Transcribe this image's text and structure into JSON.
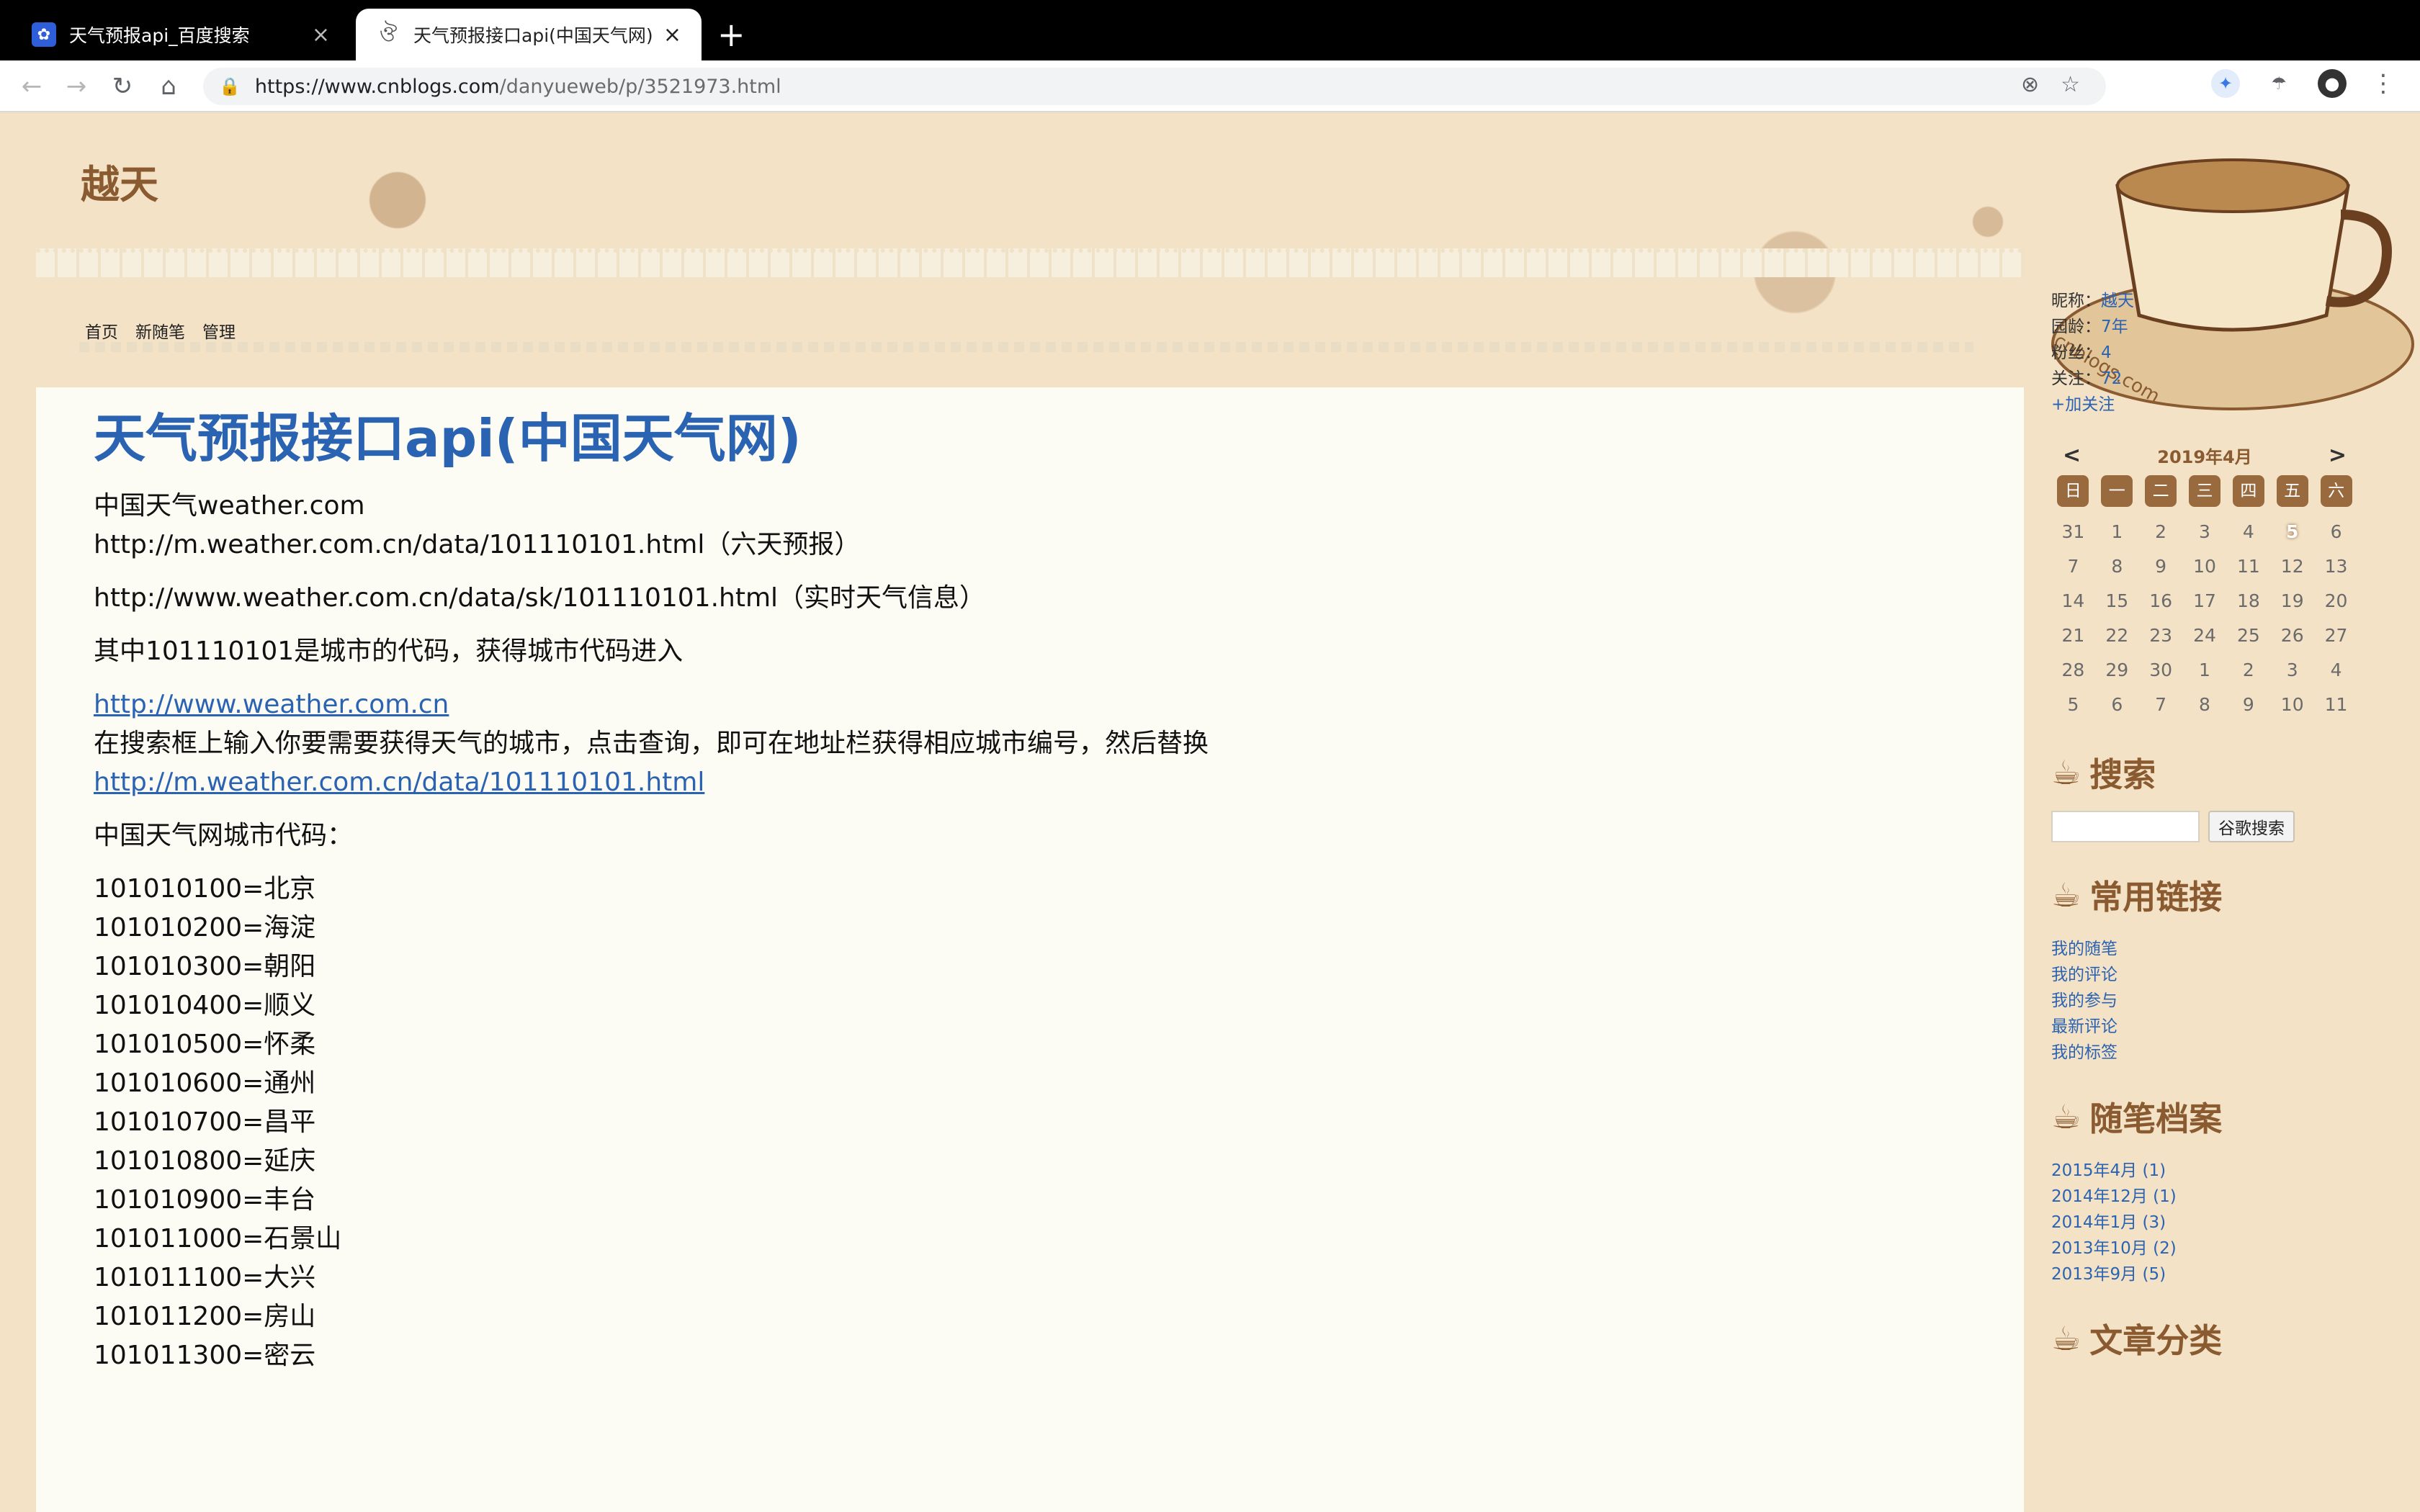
{
  "browser": {
    "tabs": [
      {
        "title": "天气预报api_百度搜索",
        "favicon": "baidu-paw-icon",
        "active": false
      },
      {
        "title": "天气预报接口api(中国天气网) - ",
        "favicon": "cnblogs-icon",
        "active": true
      }
    ],
    "url_host": "https://www.cnblogs.com",
    "url_path": "/danyueweb/p/3521973.html"
  },
  "blog": {
    "title": "越天",
    "nav": [
      "首页",
      "新随笔",
      "管理"
    ]
  },
  "post": {
    "title": "天气预报接口api(中国天气网)",
    "p1_line1": "中国天气weather.com",
    "p1_line2": "http://m.weather.com.cn/data/101110101.html（六天预报）",
    "p2": "http://www.weather.com.cn/data/sk/101110101.html（实时天气信息）",
    "p3": "其中101110101是城市的代码，获得城市代码进入",
    "link1": "http://www.weather.com.cn",
    "p4": "在搜索框上输入你要需要获得天气的城市，点击查询，即可在地址栏获得相应城市编号，然后替换",
    "link2": "http://m.weather.com.cn/data/101110101.html",
    "p5": "中国天气网城市代码：",
    "codes": [
      "101010100=北京",
      "101010200=海淀",
      "101010300=朝阳",
      "101010400=顺义",
      "101010500=怀柔",
      "101010600=通州",
      "101010700=昌平",
      "101010800=延庆",
      "101010900=丰台",
      "101011000=石景山",
      "101011100=大兴",
      "101011200=房山",
      "101011300=密云"
    ]
  },
  "sidebar": {
    "profile": [
      {
        "label": "昵称：",
        "value": "越天"
      },
      {
        "label": "园龄：",
        "value": "7年"
      },
      {
        "label": "粉丝：",
        "value": "4"
      },
      {
        "label": "关注：",
        "value": "72"
      }
    ],
    "follow": "+加关注",
    "calendar": {
      "prev": "<",
      "next": ">",
      "month": "2019年4月",
      "weekdays": [
        "日",
        "一",
        "二",
        "三",
        "四",
        "五",
        "六"
      ],
      "days": [
        "31",
        "1",
        "2",
        "3",
        "4",
        "5",
        "6",
        "7",
        "8",
        "9",
        "10",
        "11",
        "12",
        "13",
        "14",
        "15",
        "16",
        "17",
        "18",
        "19",
        "20",
        "21",
        "22",
        "23",
        "24",
        "25",
        "26",
        "27",
        "28",
        "29",
        "30",
        "1",
        "2",
        "3",
        "4",
        "5",
        "6",
        "7",
        "8",
        "9",
        "10",
        "11"
      ],
      "today": "5"
    },
    "search_heading": "搜索",
    "search_button": "谷歌搜索",
    "links_heading": "常用链接",
    "links": [
      "我的随笔",
      "我的评论",
      "我的参与",
      "最新评论",
      "我的标签"
    ],
    "archive_heading": "随笔档案",
    "archive": [
      "2015年4月 (1)",
      "2014年12月 (1)",
      "2014年1月 (3)",
      "2013年10月 (2)",
      "2013年9月 (5)"
    ],
    "category_heading": "文章分类"
  }
}
